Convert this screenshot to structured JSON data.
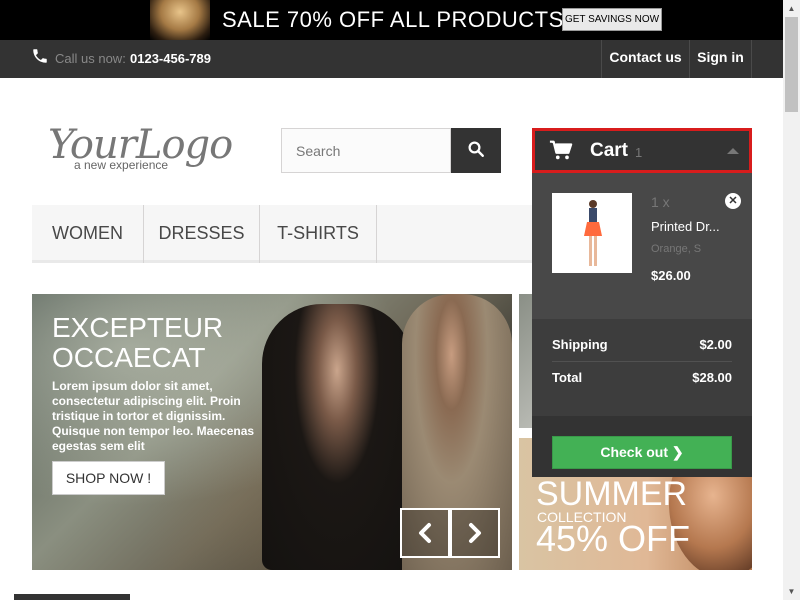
{
  "banner": {
    "text": "SALE 70% OFF ALL PRODUCTS",
    "button": "GET SAVINGS NOW"
  },
  "nav": {
    "call_label": "Call us now:",
    "phone": "0123-456-789",
    "contact": "Contact us",
    "signin": "Sign in"
  },
  "logo": {
    "main": "YourLogo",
    "tagline": "a new experience"
  },
  "search": {
    "placeholder": "Search"
  },
  "menu": {
    "items": [
      "WOMEN",
      "DRESSES",
      "T-SHIRTS"
    ]
  },
  "slider": {
    "title": "EXCEPTEUR OCCAECAT",
    "text": "Lorem ipsum dolor sit amet, consectetur adipiscing elit. Proin tristique in tortor et dignissim. Quisque non tempor leo. Maecenas egestas sem elit",
    "button": "SHOP NOW !"
  },
  "side_banner": {
    "summer": "SUMMER",
    "collection": "COLLECTION",
    "discount": "45% OFF"
  },
  "cart": {
    "label": "Cart",
    "count": "1",
    "product": {
      "qty": "1 x",
      "name": "Printed Dr...",
      "attributes": "Orange, S",
      "price": "$26.00"
    },
    "shipping_label": "Shipping",
    "shipping_value": "$2.00",
    "total_label": "Total",
    "total_value": "$28.00",
    "checkout": "Check out"
  },
  "colors": {
    "accent_red": "#d81c1c",
    "checkout_green": "#43b155",
    "dark": "#333333"
  }
}
